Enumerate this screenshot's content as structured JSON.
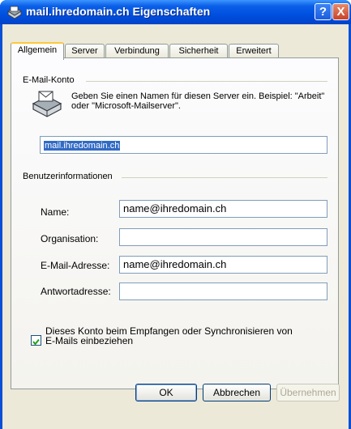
{
  "window": {
    "title": "mail.ihredomain.ch Eigenschaften",
    "help_label": "?",
    "close_label": "X"
  },
  "tabs": [
    {
      "label": "Allgemein",
      "active": true
    },
    {
      "label": "Server",
      "active": false
    },
    {
      "label": "Verbindung",
      "active": false
    },
    {
      "label": "Sicherheit",
      "active": false
    },
    {
      "label": "Erweitert",
      "active": false
    }
  ],
  "email_account": {
    "group_label": "E-Mail-Konto",
    "description": "Geben Sie einen Namen für diesen Server ein. Beispiel: \"Arbeit\" oder \"Microsoft-Mailserver\".",
    "server_name": "mail.ihredomain.ch"
  },
  "user_info": {
    "group_label": "Benutzerinformationen",
    "fields": [
      {
        "label": "Name:",
        "value": "name@ihredomain.ch"
      },
      {
        "label": "Organisation:",
        "value": ""
      },
      {
        "label": "E-Mail-Adresse:",
        "value": "name@ihredomain.ch"
      },
      {
        "label": "Antwortadresse:",
        "value": ""
      }
    ]
  },
  "include_account": {
    "checked": true,
    "label": "Dieses Konto beim Empfangen oder Synchronisieren von E-Mails einbeziehen"
  },
  "buttons": {
    "ok": "OK",
    "cancel": "Abbrechen",
    "apply": "Übernehmen"
  },
  "colors": {
    "titlebar": "#0050e0",
    "dialog_bg": "#ece9d8",
    "selection": "#316ac5",
    "checkbox_check": "#21a121"
  },
  "icons": {
    "title": "mail-account-icon",
    "account": "mail-server-icon"
  }
}
